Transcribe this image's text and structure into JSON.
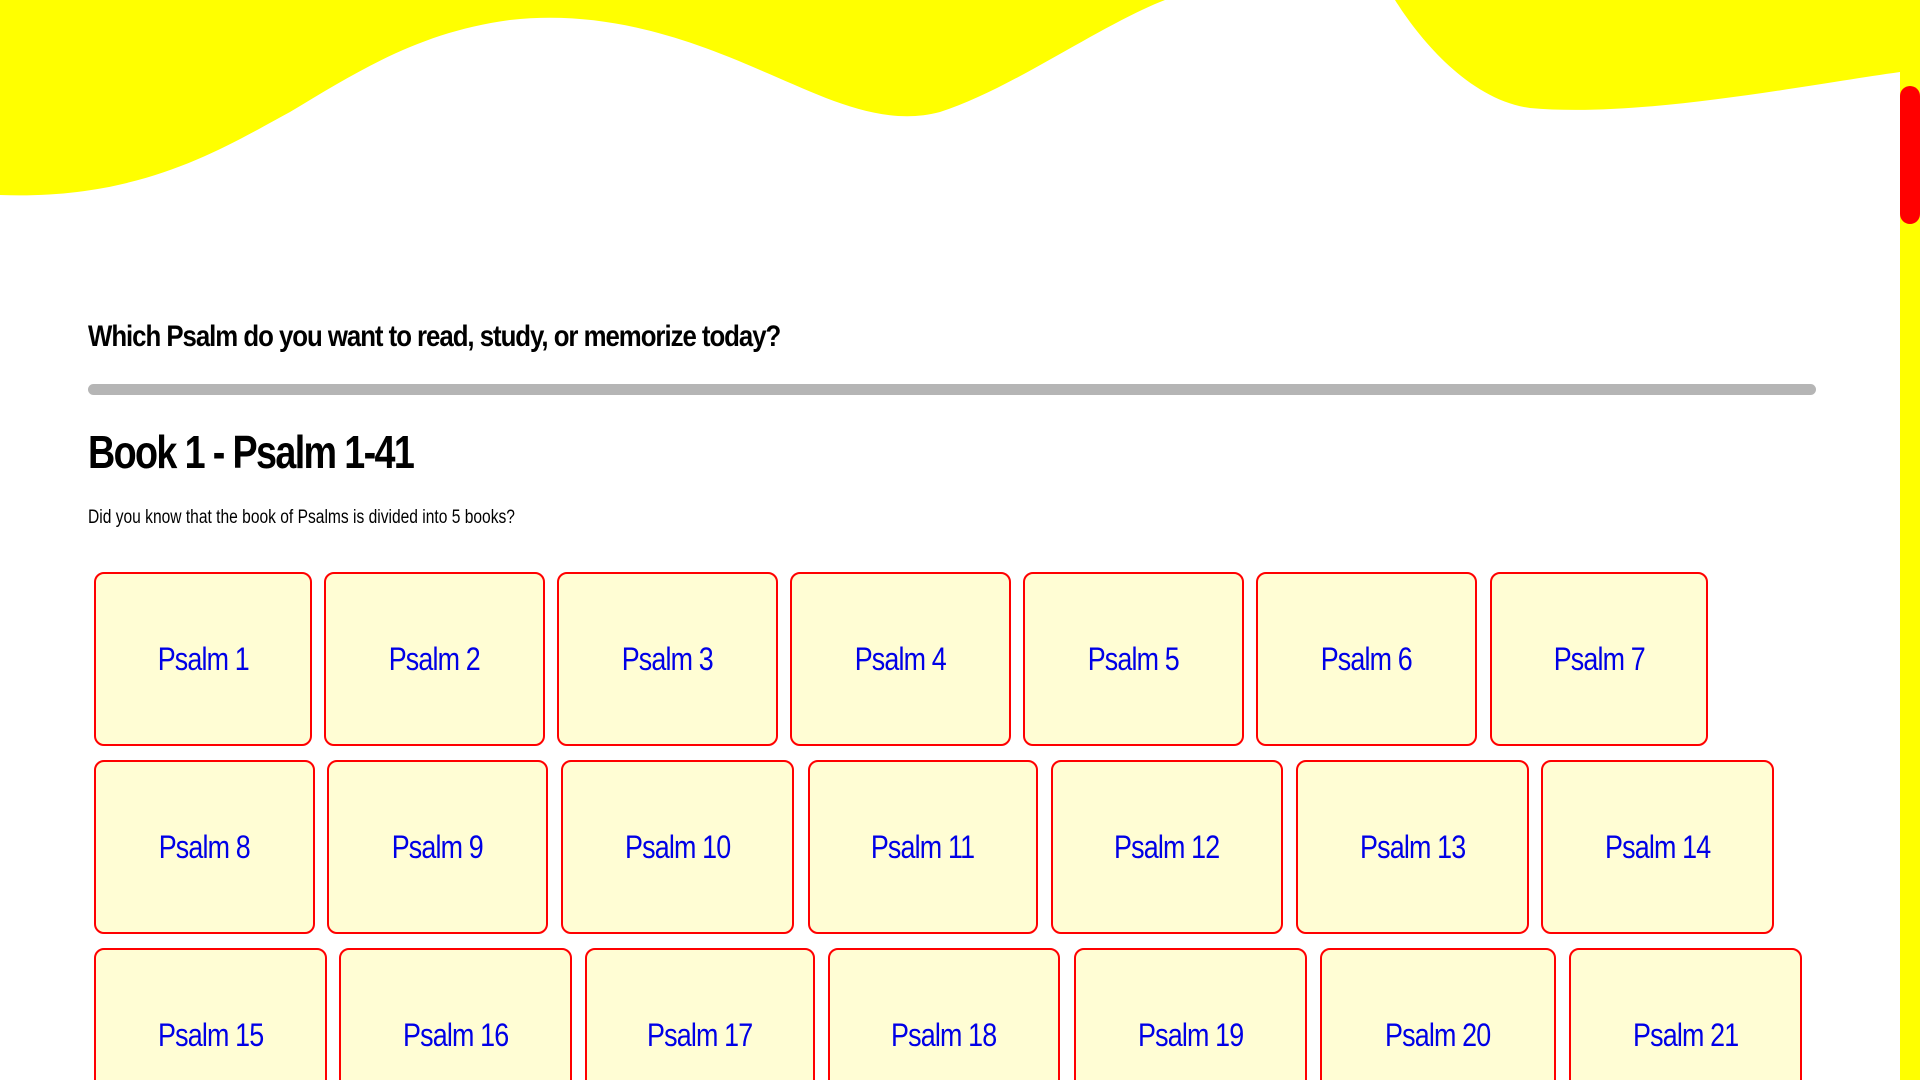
{
  "colors": {
    "wave": "#ffff00",
    "scrollbar_track": "#ffff00",
    "scrollbar_thumb": "#ff0000",
    "rule": "#b5b5b5",
    "tile_fill": "#fffdd4",
    "tile_border": "#ff0000",
    "tile_text": "#0000e6"
  },
  "question": "Which Psalm do you want to read, study, or memorize today?",
  "book": {
    "title": "Book 1 - Psalm 1-41",
    "description": "Did you know that the book of Psalms is divided into 5 books?"
  },
  "psalms": [
    "Psalm 1",
    "Psalm 2",
    "Psalm 3",
    "Psalm 4",
    "Psalm 5",
    "Psalm 6",
    "Psalm 7",
    "Psalm 8",
    "Psalm 9",
    "Psalm 10",
    "Psalm 11",
    "Psalm 12",
    "Psalm 13",
    "Psalm 14",
    "Psalm 15",
    "Psalm 16",
    "Psalm 17",
    "Psalm 18",
    "Psalm 19",
    "Psalm 20",
    "Psalm 21"
  ]
}
